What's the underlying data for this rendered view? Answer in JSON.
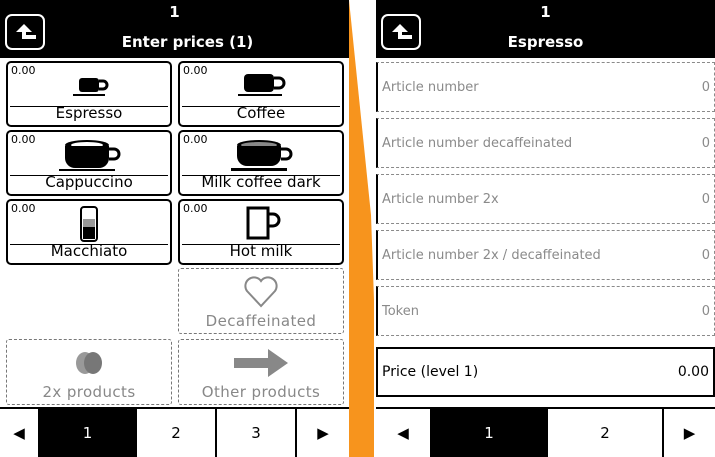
{
  "screen1": {
    "header": {
      "number": "1",
      "title": "Enter prices (1)"
    },
    "products": [
      {
        "price": "0.00",
        "label": "Espresso",
        "icon": "espresso-cup-icon"
      },
      {
        "price": "0.00",
        "label": "Coffee",
        "icon": "coffee-cup-icon"
      },
      {
        "price": "0.00",
        "label": "Cappuccino",
        "icon": "cappuccino-cup-icon"
      },
      {
        "price": "0.00",
        "label": "Milk coffee dark",
        "icon": "milk-coffee-dark-cup-icon"
      },
      {
        "price": "0.00",
        "label": "Macchiato",
        "icon": "macchiato-glass-icon"
      },
      {
        "price": "0.00",
        "label": "Hot milk",
        "icon": "hot-milk-mug-icon"
      }
    ],
    "specials": {
      "decaffeinated": {
        "label": "Decaffeinated",
        "icon": "heart-icon"
      },
      "double": {
        "label": "2x products",
        "icon": "double-beans-icon"
      },
      "other": {
        "label": "Other products",
        "icon": "right-arrow-icon"
      }
    },
    "pager": {
      "pages": [
        "1",
        "2",
        "3"
      ],
      "active": "1"
    }
  },
  "screen2": {
    "header": {
      "number": "1",
      "title": "Espresso"
    },
    "rows": [
      {
        "label": "Article number",
        "value": "0"
      },
      {
        "label": "Article number decaffeinated",
        "value": "0"
      },
      {
        "label": "Article number 2x",
        "value": "0"
      },
      {
        "label": "Article number 2x / decaffeinated",
        "value": "0"
      },
      {
        "label": "Token",
        "value": "0"
      }
    ],
    "price_row": {
      "label": "Price (level 1)",
      "value": "0.00"
    },
    "pager": {
      "pages": [
        "1",
        "2"
      ],
      "active": "1"
    }
  },
  "colors": {
    "connector": "#F7941D",
    "header_bg": "#000000",
    "disabled_text": "#888888"
  }
}
